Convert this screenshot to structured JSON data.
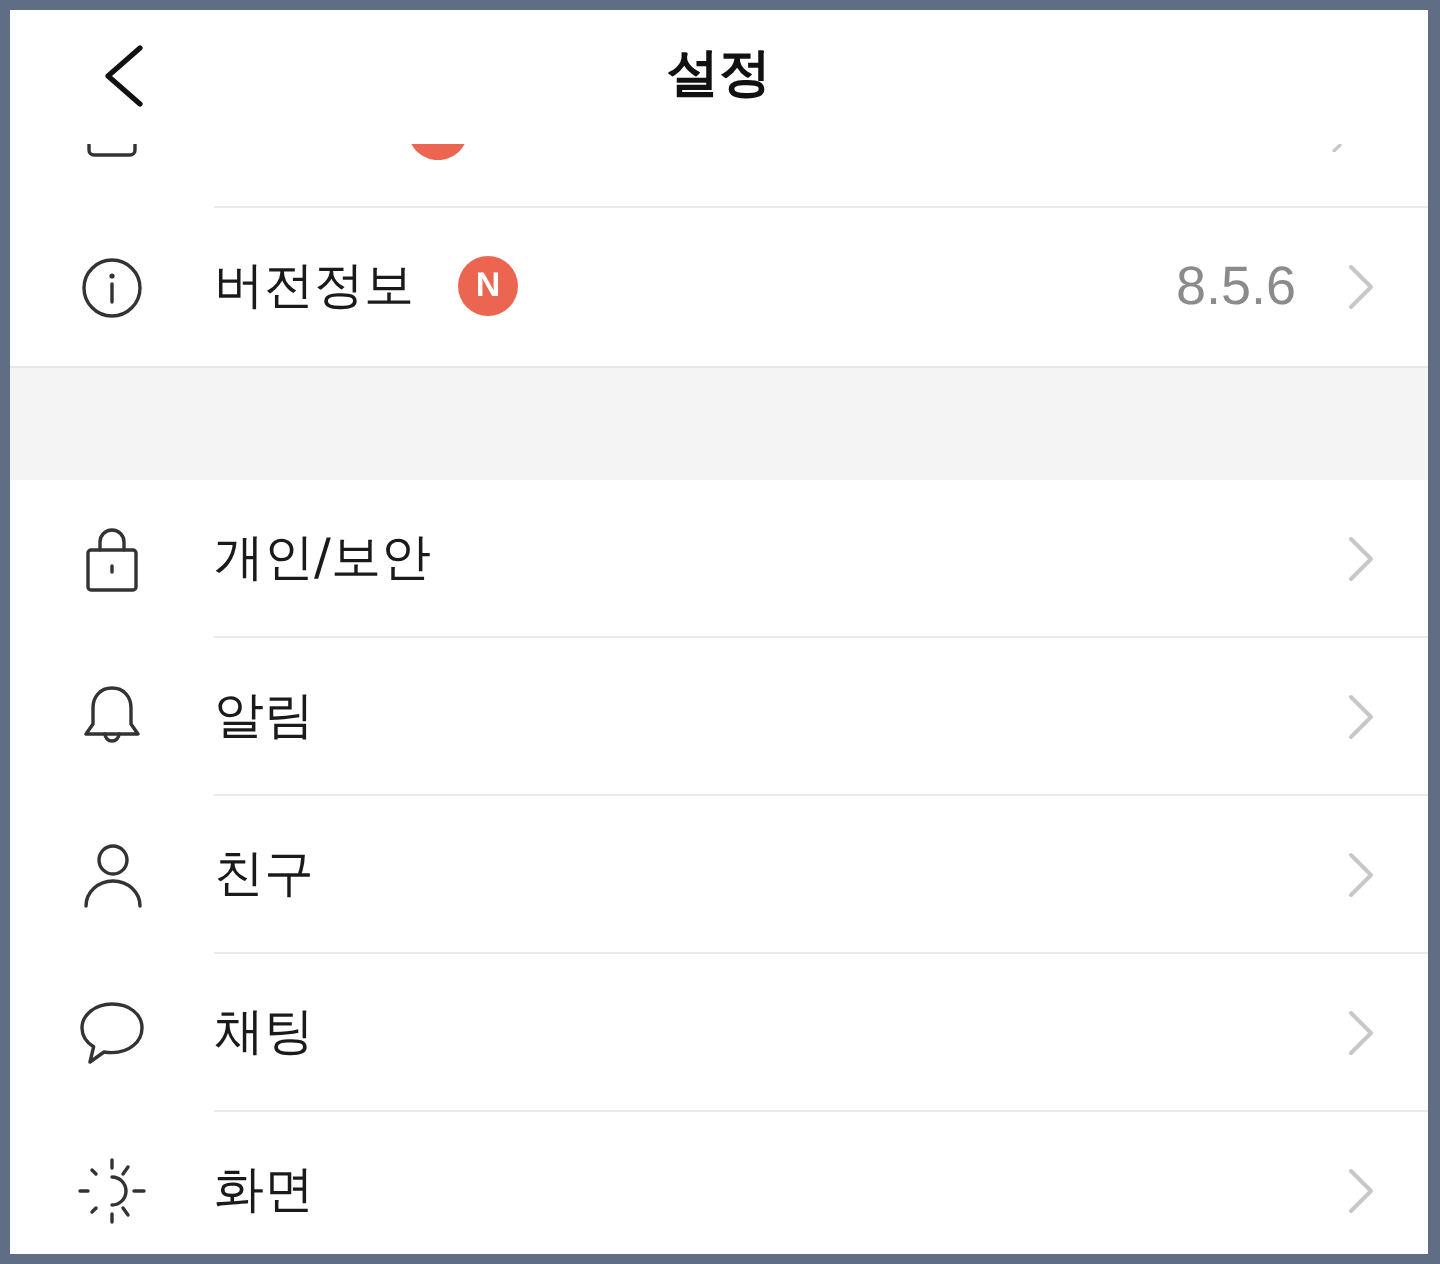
{
  "header": {
    "title": "설정"
  },
  "sections": [
    {
      "items": [
        {
          "kind": "partial",
          "new": true
        },
        {
          "kind": "row",
          "label": "버전정보",
          "new": true,
          "badge": "N",
          "value": "8.5.6"
        }
      ]
    },
    {
      "items": [
        {
          "kind": "row",
          "label": "개인/보안",
          "new": false
        },
        {
          "kind": "row",
          "label": "알림",
          "new": false
        },
        {
          "kind": "row",
          "label": "친구",
          "new": false
        },
        {
          "kind": "row",
          "label": "채팅",
          "new": false
        },
        {
          "kind": "row",
          "label": "화면",
          "new": false
        }
      ]
    }
  ]
}
